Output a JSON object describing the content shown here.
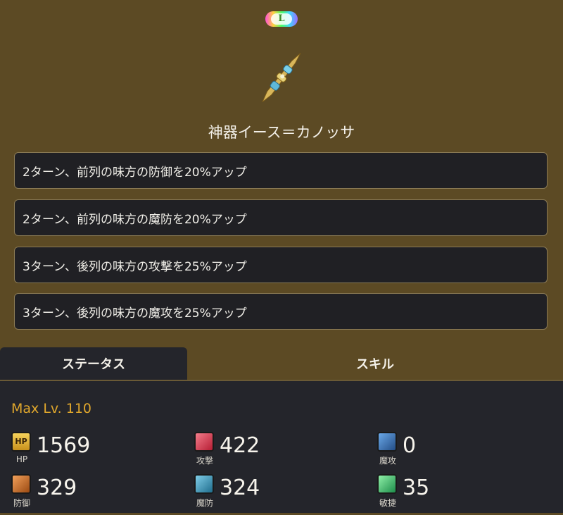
{
  "rarity": "L",
  "item_name": "神器イース＝カノッサ",
  "effects": [
    "2ターン、前列の味方の防御を20%アップ",
    "2ターン、前列の味方の魔防を20%アップ",
    "3ターン、後列の味方の攻撃を25%アップ",
    "3ターン、後列の味方の魔攻を25%アップ"
  ],
  "tabs": {
    "status": "ステータス",
    "skill": "スキル"
  },
  "max_level": "Max Lv. 110",
  "stats": {
    "hp": {
      "label": "HP",
      "value": "1569",
      "icon": "hp-icon",
      "icon_text": "HP"
    },
    "atk": {
      "label": "攻撃",
      "value": "422",
      "icon": "attack-icon"
    },
    "mag": {
      "label": "魔攻",
      "value": "0",
      "icon": "magic-attack-icon"
    },
    "def": {
      "label": "防御",
      "value": "329",
      "icon": "defense-icon"
    },
    "mdef": {
      "label": "魔防",
      "value": "324",
      "icon": "magic-defense-icon"
    },
    "agi": {
      "label": "敏捷",
      "value": "35",
      "icon": "agility-icon"
    }
  },
  "colors": {
    "background": "#5c4a24",
    "panel": "#24252b",
    "level_accent": "#e0a72c"
  }
}
